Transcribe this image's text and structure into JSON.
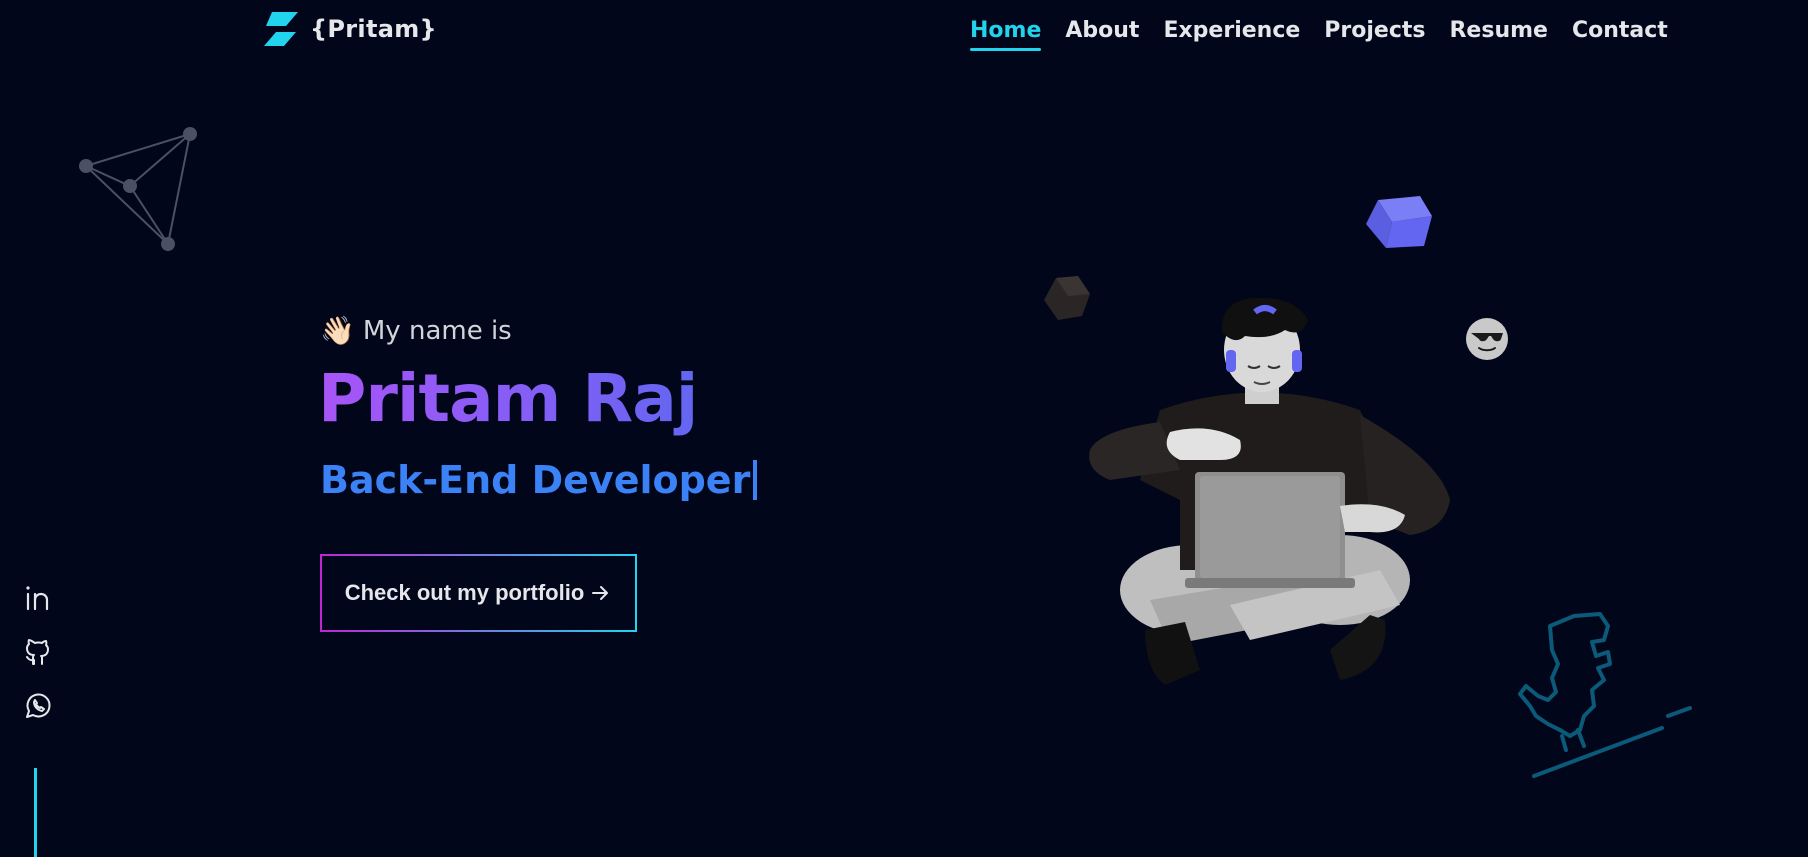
{
  "header": {
    "logo_text": "{Pritam}",
    "nav": [
      {
        "label": "Home",
        "active": true
      },
      {
        "label": "About"
      },
      {
        "label": "Experience"
      },
      {
        "label": "Projects"
      },
      {
        "label": "Resume"
      },
      {
        "label": "Contact"
      }
    ]
  },
  "hero": {
    "greeting": "My name is",
    "wave_icon": "👋🏻",
    "name": "Pritam Raj",
    "role": "Back-End Developer",
    "cta_label": "Check out my portfolio"
  },
  "social": [
    "linkedin-icon",
    "github-icon",
    "whatsapp-icon"
  ],
  "colors": {
    "background": "#02061a",
    "accent": "#22d3ee",
    "name_gradient_start": "#a855f7",
    "name_gradient_end": "#6366f1",
    "role": "#3b82f6"
  }
}
